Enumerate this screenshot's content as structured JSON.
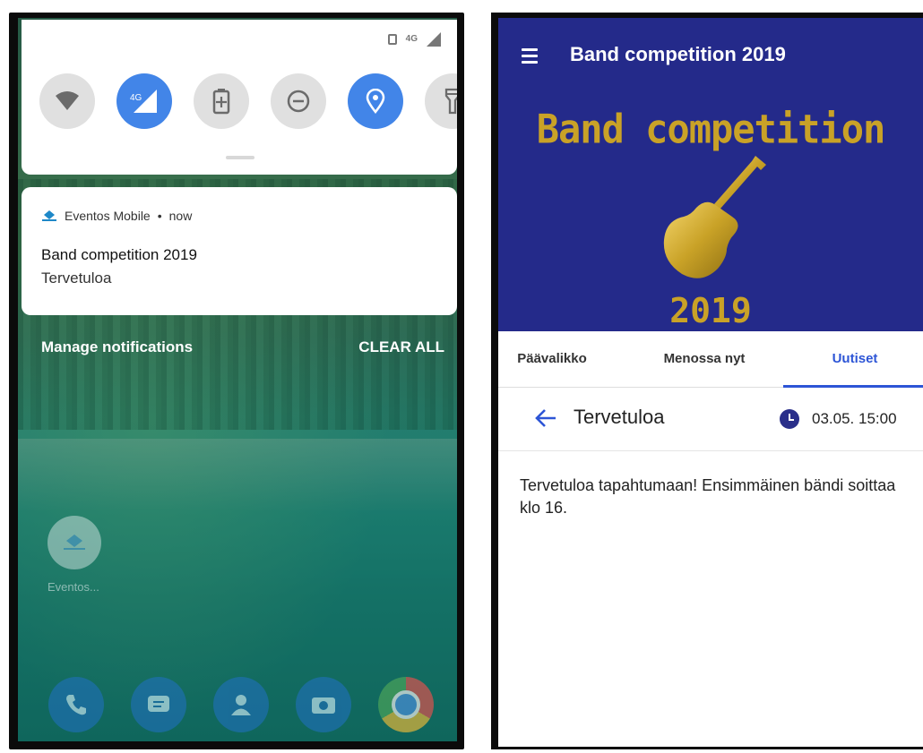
{
  "left_phone": {
    "status_bar": {
      "network": "4G"
    },
    "quick_settings": {
      "tiles": [
        {
          "name": "wifi",
          "label": "",
          "on": false
        },
        {
          "name": "mobile-data",
          "label": "4G",
          "on": true
        },
        {
          "name": "battery-saver",
          "label": "",
          "on": false
        },
        {
          "name": "do-not-disturb",
          "label": "",
          "on": false
        },
        {
          "name": "location",
          "label": "",
          "on": true
        },
        {
          "name": "flashlight",
          "label": "",
          "on": false
        }
      ]
    },
    "notification": {
      "app_name": "Eventos Mobile",
      "separator": "•",
      "time": "now",
      "title": "Band competition 2019",
      "body": "Tervetuloa"
    },
    "actions": {
      "manage": "Manage notifications",
      "clear": "CLEAR ALL"
    },
    "home": {
      "shortcut_label": "Eventos..."
    },
    "dock": [
      "phone-icon",
      "messages-icon",
      "contacts-icon",
      "camera-icon",
      "chrome-icon"
    ]
  },
  "right_phone": {
    "app_bar": {
      "title": "Band competition 2019"
    },
    "banner": {
      "title": "Band competition",
      "year": "2019"
    },
    "tabs": [
      {
        "label": "Päävalikko",
        "active": false
      },
      {
        "label": "Menossa nyt",
        "active": false
      },
      {
        "label": "Uutiset",
        "active": true
      }
    ],
    "news": {
      "title": "Tervetuloa",
      "date": "03.05. 15:00",
      "body": "Tervetuloa tapahtumaan! Ensimmäinen bändi soittaa klo 16."
    }
  },
  "colors": {
    "header_blue": "#242a8a",
    "accent_blue": "#2d55d6",
    "gold": "#c9a227",
    "qs_active": "#4285e8"
  }
}
